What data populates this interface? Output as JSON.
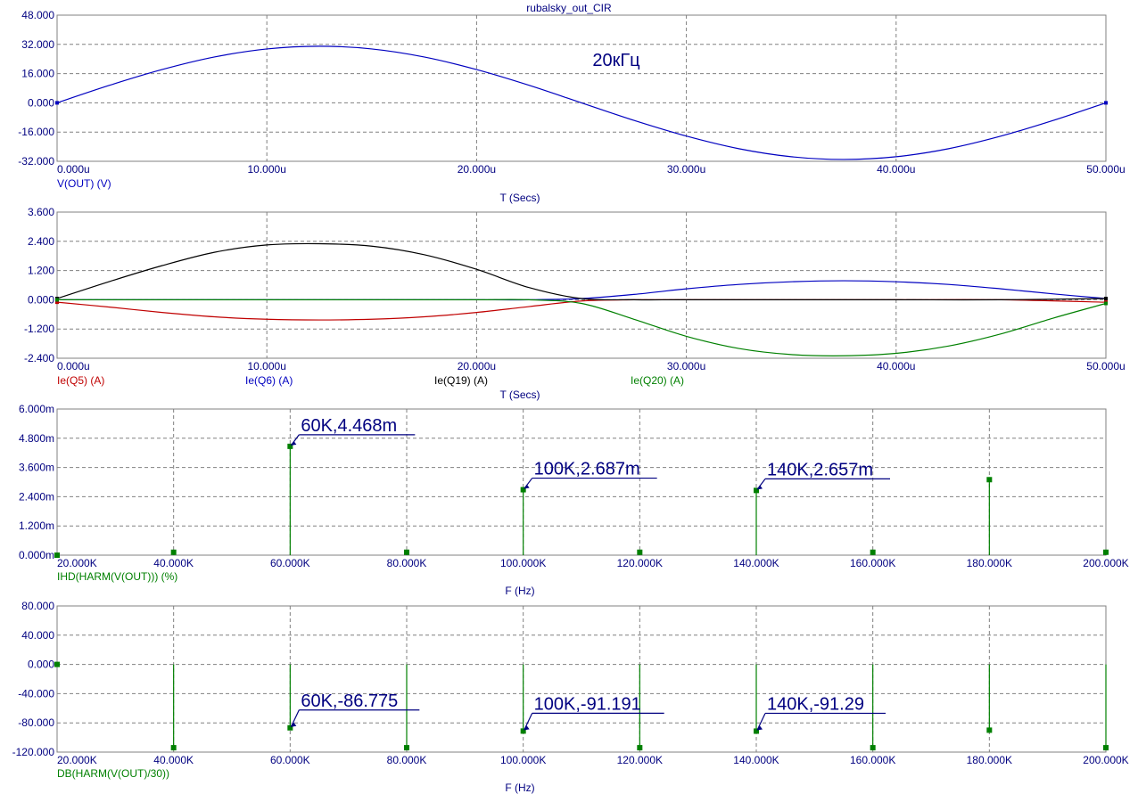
{
  "title": "rubalsky_out_CIR",
  "annotation_text": "20кГц",
  "colors": {
    "axis_text": "#000080",
    "grid": "#808080",
    "blue": "#0000c0",
    "red": "#c00000",
    "black": "#000000",
    "green": "#008000",
    "title": "#000080"
  },
  "chart_data": [
    {
      "type": "line",
      "xlabel": "T (Secs)",
      "xlim": [
        0,
        5e-05
      ],
      "ylim": [
        -32,
        48
      ],
      "x_ticks": [
        "0.000u",
        "10.000u",
        "20.000u",
        "30.000u",
        "40.000u",
        "50.000u"
      ],
      "y_ticks": [
        "48.000",
        "32.000",
        "16.000",
        "0.000",
        "-16.000",
        "-32.000"
      ],
      "series": [
        {
          "name": "V(OUT) (V)",
          "color": "#0000c0",
          "x": [
            0,
            2.5e-06,
            5e-06,
            7.5e-06,
            1e-05,
            1.25e-05,
            1.5e-05,
            1.75e-05,
            2e-05,
            2.25e-05,
            2.5e-05,
            2.75e-05,
            3e-05,
            3.25e-05,
            3.5e-05,
            3.75e-05,
            4e-05,
            4.25e-05,
            4.5e-05,
            4.75e-05,
            5e-05
          ],
          "y": [
            0,
            9.6,
            18.2,
            25.1,
            29.5,
            31.0,
            29.5,
            25.1,
            18.2,
            9.6,
            0,
            -9.6,
            -18.2,
            -25.1,
            -29.5,
            -31.0,
            -29.5,
            -25.1,
            -18.2,
            -9.6,
            0
          ]
        }
      ]
    },
    {
      "type": "line",
      "xlabel": "T (Secs)",
      "xlim": [
        0,
        5e-05
      ],
      "ylim": [
        -2.4,
        3.6
      ],
      "x_ticks": [
        "0.000u",
        "10.000u",
        "20.000u",
        "30.000u",
        "40.000u",
        "50.000u"
      ],
      "y_ticks": [
        "3.600",
        "2.400",
        "1.200",
        "0.000",
        "-1.200",
        "-2.400"
      ],
      "series": [
        {
          "name": "Ie(Q5) (A)",
          "color": "#c00000",
          "x": [
            0,
            2.5e-06,
            5e-06,
            7.5e-06,
            1e-05,
            1.25e-05,
            1.5e-05,
            1.75e-05,
            2e-05,
            2.25e-05,
            2.5e-05,
            2.75e-05,
            3e-05,
            3.5e-05,
            4e-05,
            4.5e-05,
            5e-05
          ],
          "y": [
            -0.1,
            -0.3,
            -0.52,
            -0.7,
            -0.8,
            -0.83,
            -0.8,
            -0.7,
            -0.52,
            -0.28,
            -0.05,
            0,
            0,
            0,
            0,
            0,
            -0.1
          ]
        },
        {
          "name": "Ie(Q6) (A)",
          "color": "#0000c0",
          "x": [
            0,
            2.5e-06,
            5e-06,
            7.5e-06,
            1e-05,
            1.25e-05,
            1.5e-05,
            1.75e-05,
            2e-05,
            2.25e-05,
            2.5e-05,
            2.75e-05,
            3e-05,
            3.25e-05,
            3.5e-05,
            3.75e-05,
            4e-05,
            4.25e-05,
            4.5e-05,
            4.75e-05,
            5e-05
          ],
          "y": [
            0,
            0,
            0,
            0,
            0,
            0,
            0,
            0,
            0,
            0,
            0.05,
            0.22,
            0.45,
            0.63,
            0.74,
            0.78,
            0.74,
            0.63,
            0.45,
            0.24,
            0.05
          ]
        },
        {
          "name": "Ie(Q19) (A)",
          "color": "#000000",
          "x": [
            0,
            2.5e-06,
            5e-06,
            7.5e-06,
            1e-05,
            1.25e-05,
            1.5e-05,
            1.75e-05,
            2e-05,
            2.25e-05,
            2.5e-05,
            2.75e-05,
            3e-05,
            3.5e-05,
            4e-05,
            4.5e-05,
            5e-05
          ],
          "y": [
            0.05,
            0.75,
            1.4,
            1.95,
            2.25,
            2.3,
            2.2,
            1.85,
            1.25,
            0.5,
            0.05,
            0,
            0,
            0,
            0,
            0,
            0.05
          ]
        },
        {
          "name": "Ie(Q20) (A)",
          "color": "#008000",
          "x": [
            0,
            2.5e-06,
            5e-06,
            7.5e-06,
            1e-05,
            1.25e-05,
            1.5e-05,
            1.75e-05,
            2e-05,
            2.25e-05,
            2.5e-05,
            2.75e-05,
            3e-05,
            3.25e-05,
            3.5e-05,
            3.75e-05,
            4e-05,
            4.25e-05,
            4.5e-05,
            4.75e-05,
            5e-05
          ],
          "y": [
            0,
            0,
            0,
            0,
            0,
            0,
            0,
            0,
            0,
            0,
            -0.15,
            -0.8,
            -1.5,
            -2.0,
            -2.25,
            -2.3,
            -2.2,
            -1.9,
            -1.4,
            -0.75,
            -0.15
          ]
        }
      ]
    },
    {
      "type": "bar",
      "xlabel": "F (Hz)",
      "xlim": [
        20000,
        200000
      ],
      "ylim": [
        0,
        0.006
      ],
      "x_ticks": [
        "20.000K",
        "40.000K",
        "60.000K",
        "80.000K",
        "100.000K",
        "120.000K",
        "140.000K",
        "160.000K",
        "180.000K",
        "200.000K"
      ],
      "y_ticks": [
        "6.000m",
        "4.800m",
        "3.600m",
        "2.400m",
        "1.200m",
        "0.000m"
      ],
      "series": [
        {
          "name": "IHD(HARM(V(OUT))) (%)",
          "color": "#008000",
          "x": [
            20000,
            40000,
            60000,
            80000,
            100000,
            120000,
            140000,
            160000,
            180000,
            200000
          ],
          "y": [
            0,
            0.00012,
            0.004468,
            0.00012,
            0.002687,
            0.00012,
            0.002657,
            0.00012,
            0.0031,
            0.00012
          ]
        }
      ],
      "annotations": [
        {
          "text": "60K,4.468m",
          "x": 60000,
          "y": 0.004468
        },
        {
          "text": "100K,2.687m",
          "x": 100000,
          "y": 0.002687
        },
        {
          "text": "140K,2.657m",
          "x": 140000,
          "y": 0.002657
        }
      ]
    },
    {
      "type": "bar",
      "xlabel": "F (Hz)",
      "xlim": [
        20000,
        200000
      ],
      "ylim": [
        -120,
        80
      ],
      "x_ticks": [
        "20.000K",
        "40.000K",
        "60.000K",
        "80.000K",
        "100.000K",
        "120.000K",
        "140.000K",
        "160.000K",
        "180.000K",
        "200.000K"
      ],
      "y_ticks": [
        "80.000",
        "40.000",
        "0.000",
        "-40.000",
        "-80.000",
        "-120.000"
      ],
      "series": [
        {
          "name": "DB(HARM(V(OUT)/30))",
          "color": "#008000",
          "x": [
            20000,
            40000,
            60000,
            80000,
            100000,
            120000,
            140000,
            160000,
            180000,
            200000
          ],
          "y": [
            0,
            -114,
            -86.775,
            -114,
            -91.191,
            -114,
            -91.29,
            -114,
            -90,
            -114
          ]
        }
      ],
      "annotations": [
        {
          "text": "60K,-86.775",
          "x": 60000,
          "y": -86.775
        },
        {
          "text": "100K,-91.191",
          "x": 100000,
          "y": -91.191
        },
        {
          "text": "140K,-91.29",
          "x": 140000,
          "y": -91.29
        }
      ]
    }
  ]
}
